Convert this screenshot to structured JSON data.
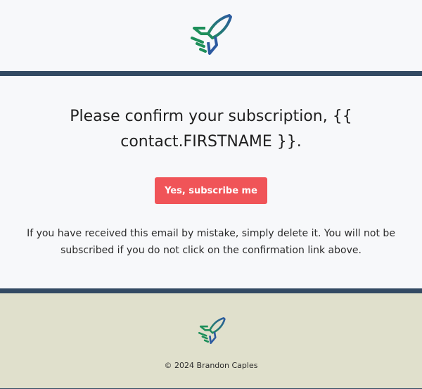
{
  "email": {
    "heading": "Please confirm your subscription, {{ contact.FIRSTNAME }}.",
    "button_label": "Yes, subscribe me",
    "note": "If you have received this email by mistake, simply delete it. You will not be subscribed if you do not click on the confirmation link above."
  },
  "footer": {
    "copyright": "© 2024 Brandon Caples"
  },
  "icons": {
    "top_logo": "rocket-icon",
    "bottom_logo": "rocket-icon"
  },
  "colors": {
    "divider": "#334a63",
    "button": "#f05458",
    "footer_bg": "#e0e0cc",
    "logo_green": "#1e8f5a",
    "logo_blue": "#2c5aa0"
  }
}
